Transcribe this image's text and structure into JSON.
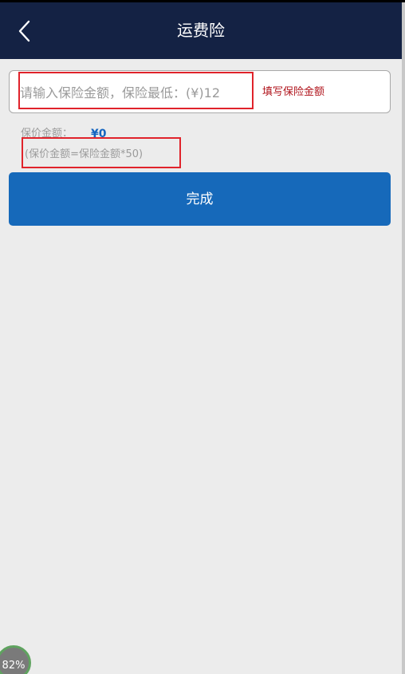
{
  "header": {
    "title": "运费险",
    "back_icon": "chevron-left-icon"
  },
  "amount_input": {
    "placeholder": "请输入保险金额，保险最低：(¥)12",
    "value": "",
    "hint": "填写保险金额"
  },
  "insured": {
    "label": "保价金额：",
    "value": "¥0",
    "formula": "(保价金额=保险金额*50)"
  },
  "actions": {
    "done_label": "完成"
  },
  "overlay": {
    "zoom_label": "82%"
  },
  "colors": {
    "header_bg": "#142244",
    "button_bg": "#1669ba",
    "highlight_border": "#e0232b",
    "hint_text": "#b0141c",
    "value_text": "#1565c0"
  }
}
